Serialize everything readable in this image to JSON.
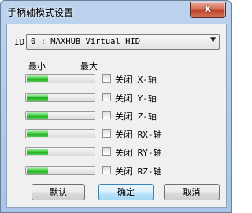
{
  "window": {
    "title": "手柄轴模式设置",
    "close_symbol": "x",
    "close_icon": "close-icon"
  },
  "id_select": {
    "label": "ID",
    "value": "0 : MAXHUB Virtual HID",
    "arrow": "▼"
  },
  "columns": {
    "min": "最小",
    "max": "最大"
  },
  "axes": [
    {
      "label": "关闭 X-轴",
      "checked": false,
      "level": 0.33
    },
    {
      "label": "关闭 Y-轴",
      "checked": false,
      "level": 0.33
    },
    {
      "label": "关闭 Z-轴",
      "checked": false,
      "level": 0.33
    },
    {
      "label": "关闭 RX-轴",
      "checked": false,
      "level": 0.33
    },
    {
      "label": "关闭 RY-轴",
      "checked": false,
      "level": 0.33
    },
    {
      "label": "关闭 RZ-轴",
      "checked": false,
      "level": 0.33
    }
  ],
  "buttons": {
    "default": "默认",
    "ok": "确定",
    "cancel": "取消"
  },
  "colors": {
    "bar_fill": "#2fbf2f",
    "title_bar": "#b4cdeb",
    "close_button": "#c8462b"
  }
}
